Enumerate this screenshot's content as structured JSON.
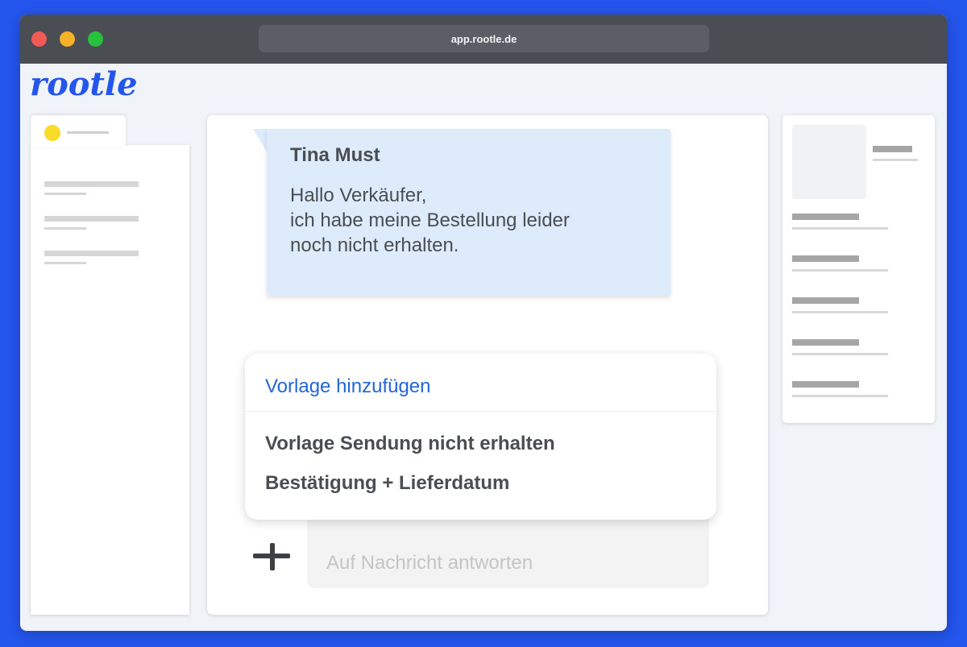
{
  "browser": {
    "url": "app.rootle.de"
  },
  "app": {
    "logo": "rootle"
  },
  "message": {
    "sender": "Tina Must",
    "lines": [
      "Hallo Verkäufer,",
      "ich habe meine Bestellung leider",
      "noch nicht erhalten."
    ]
  },
  "template_menu": {
    "header": "Vorlage hinzufügen",
    "items": [
      {
        "label": "Vorlage Sendung nicht erhalten"
      },
      {
        "label": "Bestätigung + Lieferdatum"
      }
    ]
  },
  "reply": {
    "placeholder": "Auf Nachricht antworten"
  },
  "colors": {
    "background": "#2456ee",
    "accent": "#2466d8",
    "bubble": "#deebfb",
    "status_dot": "#fbdb28"
  },
  "icons": {
    "add": "plus-icon"
  }
}
